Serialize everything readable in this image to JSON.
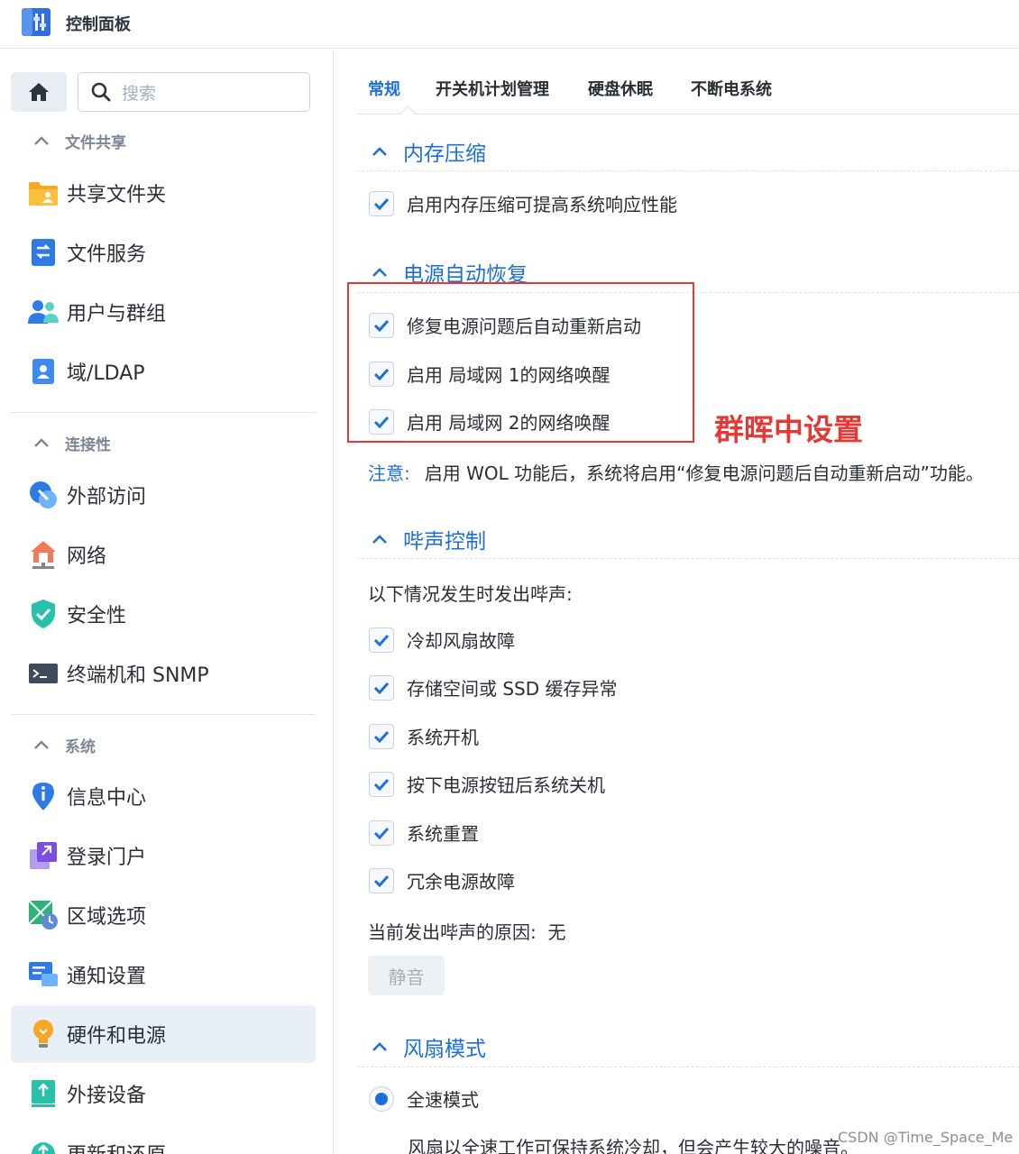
{
  "window": {
    "title": "控制面板"
  },
  "search": {
    "placeholder": "搜索"
  },
  "sidebar": {
    "groups": [
      {
        "label": "文件共享",
        "items": [
          {
            "label": "共享文件夹",
            "icon": "shared-folder-icon"
          },
          {
            "label": "文件服务",
            "icon": "file-services-icon"
          },
          {
            "label": "用户与群组",
            "icon": "user-group-icon"
          },
          {
            "label": "域/LDAP",
            "icon": "domain-ldap-icon"
          }
        ]
      },
      {
        "label": "连接性",
        "items": [
          {
            "label": "外部访问",
            "icon": "external-access-icon"
          },
          {
            "label": "网络",
            "icon": "network-icon"
          },
          {
            "label": "安全性",
            "icon": "security-shield-icon"
          },
          {
            "label": "终端机和 SNMP",
            "icon": "terminal-icon"
          }
        ]
      },
      {
        "label": "系统",
        "items": [
          {
            "label": "信息中心",
            "icon": "info-center-icon"
          },
          {
            "label": "登录门户",
            "icon": "login-portal-icon"
          },
          {
            "label": "区域选项",
            "icon": "regional-options-icon"
          },
          {
            "label": "通知设置",
            "icon": "notification-icon"
          },
          {
            "label": "硬件和电源",
            "icon": "hardware-power-icon",
            "active": true
          },
          {
            "label": "外接设备",
            "icon": "external-devices-icon"
          },
          {
            "label": "更新和还原",
            "icon": "update-restore-icon"
          }
        ]
      }
    ]
  },
  "tabs": [
    {
      "label": "常规",
      "active": true
    },
    {
      "label": "开关机计划管理"
    },
    {
      "label": "硬盘休眠"
    },
    {
      "label": "不断电系统"
    }
  ],
  "sections": {
    "memory": {
      "title": "内存压缩",
      "options": [
        {
          "label": "启用内存压缩可提高系统响应性能",
          "checked": true
        }
      ]
    },
    "power_recovery": {
      "title": "电源自动恢复",
      "options": [
        {
          "label": "修复电源问题后自动重新启动",
          "checked": true
        },
        {
          "label": "启用 局域网 1的网络唤醒",
          "checked": true
        },
        {
          "label": "启用 局域网 2的网络唤醒",
          "checked": true
        }
      ],
      "note_label": "注意:",
      "note_text": "启用 WOL 功能后，系统将启用“修复电源问题后自动重新启动”功能。"
    },
    "beep": {
      "title": "哔声控制",
      "intro": "以下情况发生时发出哔声:",
      "options": [
        {
          "label": "冷却风扇故障",
          "checked": true
        },
        {
          "label": "存储空间或 SSD 缓存异常",
          "checked": true
        },
        {
          "label": "系统开机",
          "checked": true
        },
        {
          "label": "按下电源按钮后系统关机",
          "checked": true
        },
        {
          "label": "系统重置",
          "checked": true
        },
        {
          "label": "冗余电源故障",
          "checked": true
        }
      ],
      "reason_label": "当前发出哔声的原因:",
      "reason_value": "无",
      "mute_label": "静音"
    },
    "fan": {
      "title": "风扇模式",
      "options": [
        {
          "label": "全速模式",
          "selected": true
        }
      ],
      "description": "风扇以全速工作可保持系统冷却，但会产生较大的噪音。"
    }
  },
  "annotation": {
    "text": "群晖中设置",
    "color": "#e53935"
  },
  "watermark": "CSDN @Time_Space_Me",
  "colors": {
    "accent": "#1d6fd8",
    "annotation_red": "#e53935"
  }
}
